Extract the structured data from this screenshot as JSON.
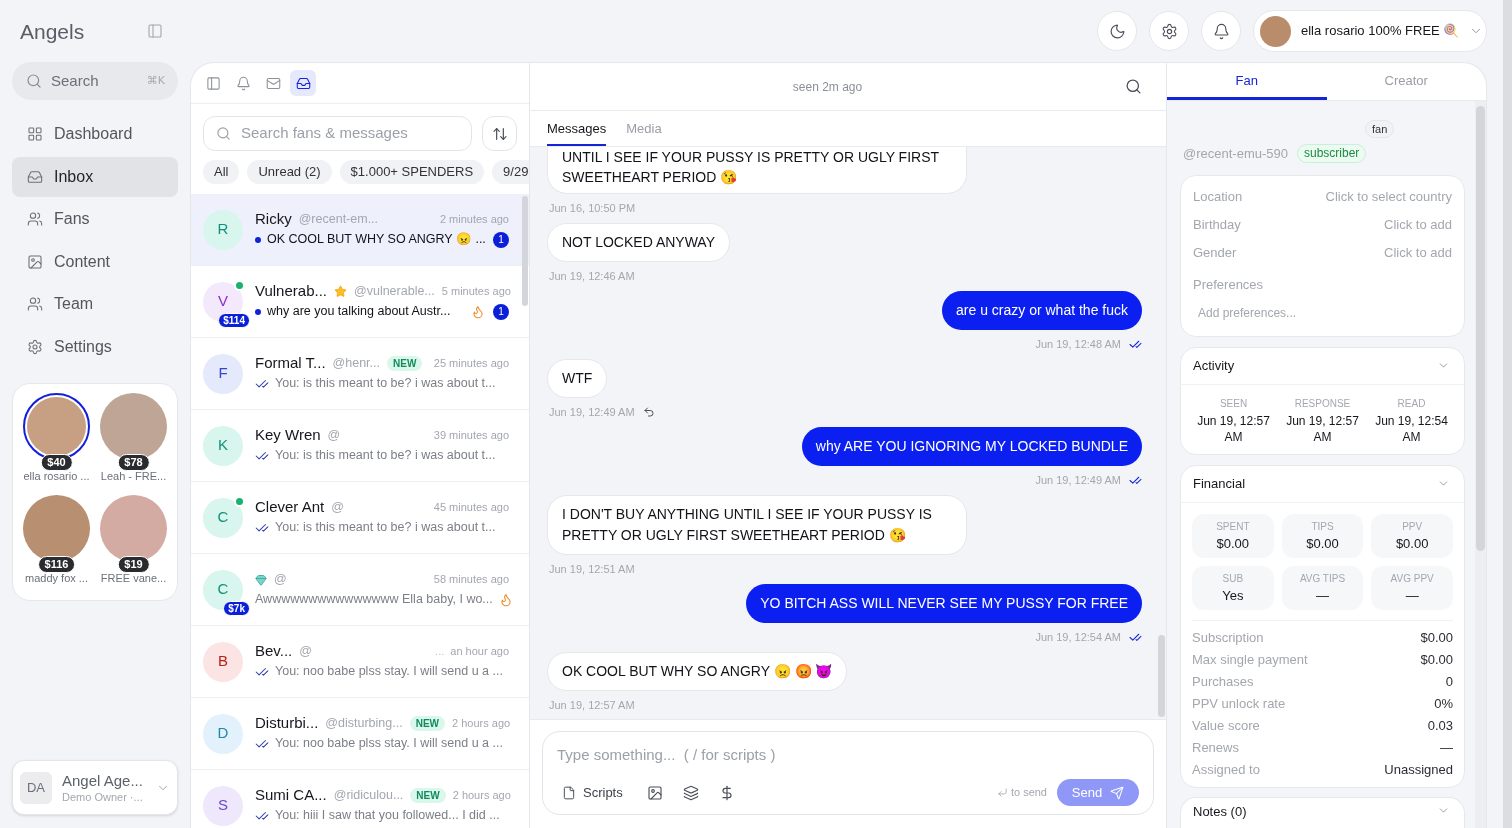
{
  "sidebar": {
    "brand": "Angels",
    "search": {
      "label": "Search",
      "shortcut": "⌘K"
    },
    "nav": [
      {
        "kind": "grid",
        "label": "Dashboard",
        "selected": false
      },
      {
        "kind": "inbox",
        "label": "Inbox",
        "selected": true
      },
      {
        "kind": "users",
        "label": "Fans",
        "selected": false
      },
      {
        "kind": "image",
        "label": "Content",
        "selected": false
      },
      {
        "kind": "users",
        "label": "Team",
        "selected": false
      },
      {
        "kind": "settings",
        "label": "Settings",
        "selected": false
      }
    ],
    "creators": [
      {
        "name": "ella rosario ...",
        "earnings": "$40",
        "selected": true
      },
      {
        "name": "Leah - FRE...",
        "earnings": "$78",
        "selected": false
      },
      {
        "name": "maddy fox ...",
        "earnings": "$116",
        "selected": false
      },
      {
        "name": "FREE vane...",
        "earnings": "$19",
        "selected": false
      }
    ],
    "user": {
      "initials": "DA",
      "name": "Angel Age...",
      "role": "Demo Owner ·..."
    }
  },
  "top_bar": {
    "account": {
      "name": "ella rosario 100% FREE 🍭"
    }
  },
  "inbox": {
    "toolbar": [
      {
        "kind": "panel",
        "selected": false
      },
      {
        "kind": "bell",
        "selected": false
      },
      {
        "kind": "mail",
        "selected": false
      },
      {
        "kind": "inbox",
        "selected": true
      }
    ],
    "search": {
      "placeholder": "Search fans & messages"
    },
    "filters": [
      "All",
      "Unread (2)",
      "$1.000+ SPENDERS",
      "9/29"
    ],
    "conversations": [
      {
        "kind": "plain",
        "initial": "R",
        "color": "#d8f6ee",
        "name": "Ricky",
        "handle": "@recent-em...",
        "time": "2 minutes ago",
        "preview": "OK COOL BUT WHY SO ANGRY 😠 ...",
        "unread": true,
        "unread_count": "1",
        "read": false,
        "online": false,
        "hot": false,
        "selected": true
      },
      {
        "kind": "star",
        "initial": "V",
        "color": "#f3e8fc",
        "name": "Vulnerab...",
        "handle": "@vulnerable...",
        "time": "5 minutes ago",
        "preview": "why are you talking about Austr...",
        "unread": true,
        "unread_count": "1",
        "read": false,
        "online": true,
        "spend": "$114",
        "hot": true,
        "selected": false
      },
      {
        "kind": "plain",
        "initial": "F",
        "color": "#e4e9fb",
        "name": "Formal T...",
        "handle": "@henr...",
        "tag": "NEW",
        "time": "25 minutes ago",
        "preview": "You: is this meant to be? i was about t...",
        "unread": false,
        "read": true,
        "online": false,
        "hot": false,
        "selected": false
      },
      {
        "kind": "plain",
        "initial": "K",
        "color": "#d8f6ee",
        "name": "Key Wren",
        "handle": "@",
        "time": "39 minutes ago",
        "preview": "You: is this meant to be? i was about t...",
        "unread": false,
        "read": true,
        "online": false,
        "hot": false,
        "selected": false
      },
      {
        "kind": "plain",
        "initial": "C",
        "color": "#d8f6ee",
        "name": "Clever Ant",
        "handle": "@",
        "time": "45 minutes ago",
        "preview": "You: is this meant to be? i was about t...",
        "unread": false,
        "read": true,
        "online": true,
        "hot": false,
        "selected": false
      },
      {
        "kind": "gem",
        "initial": "C",
        "color": "#d8f6ee",
        "handle": "@",
        "time": "58 minutes ago",
        "preview": "Awwwwwwwwwwwwwww Ella baby, I wo...",
        "unread": false,
        "read": false,
        "online": false,
        "spend": "$7k",
        "hot": true,
        "selected": false
      },
      {
        "kind": "plain",
        "initial": "B",
        "color": "#fde4e4",
        "name": "Bev...",
        "handle": "@",
        "time_prefix": "...",
        "time": "an hour ago",
        "preview": "You: noo babe plss stay. I will send u a ...",
        "unread": false,
        "read": true,
        "online": false,
        "hot": false,
        "selected": false
      },
      {
        "kind": "plain",
        "initial": "D",
        "color": "#e2f1fc",
        "name": "Disturbi...",
        "handle": "@disturbing...",
        "tag": "NEW",
        "time": "2 hours ago",
        "preview": "You: noo babe plss stay. I will send u a ...",
        "unread": false,
        "read": true,
        "online": false,
        "hot": false,
        "selected": false
      },
      {
        "kind": "plain",
        "initial": "S",
        "color": "#efe7fb",
        "name": "Sumi CA...",
        "handle": "@ridiculou...",
        "tag": "NEW",
        "time": "2 hours ago",
        "preview": "You: hiii I saw that you followed... I did ...",
        "unread": false,
        "read": true,
        "online": false,
        "hot": false,
        "selected": false
      }
    ]
  },
  "chat": {
    "status": "seen 2m ago",
    "tabs": [
      {
        "label": "Messages",
        "selected": true
      },
      {
        "label": "Media",
        "selected": false
      }
    ],
    "messages": [
      {
        "kind": "incoming",
        "text": "UNTIL I SEE IF YOUR PUSSY IS PRETTY OR UGLY FIRST SWEETHEART PERIOD 😘",
        "time": "Jun 16, 10:50 PM",
        "cut_off": true,
        "read": false,
        "replied": false
      },
      {
        "kind": "incoming",
        "text": "NOT LOCKED ANYWAY",
        "time": "Jun 19, 12:46 AM",
        "cut_off": false,
        "read": false,
        "replied": false
      },
      {
        "kind": "outgoing",
        "text": "are u crazy or what the fuck",
        "time": "Jun 19, 12:48 AM",
        "cut_off": false,
        "read": true,
        "replied": false
      },
      {
        "kind": "incoming",
        "text": "WTF",
        "time": "Jun 19, 12:49 AM",
        "cut_off": false,
        "read": false,
        "replied": true
      },
      {
        "kind": "outgoing",
        "text": "why ARE YOU IGNORING MY LOCKED BUNDLE",
        "time": "Jun 19, 12:49 AM",
        "cut_off": false,
        "read": true,
        "replied": false
      },
      {
        "kind": "incoming",
        "text": "I DON'T BUY ANYTHING UNTIL I SEE IF YOUR PUSSY IS PRETTY OR UGLY FIRST SWEETHEART PERIOD 😘",
        "time": "Jun 19, 12:51 AM",
        "cut_off": false,
        "read": false,
        "replied": false
      },
      {
        "kind": "outgoing",
        "text": "YO BITCH ASS WILL NEVER SEE MY PUSSY FOR FREE",
        "time": "Jun 19, 12:54 AM",
        "cut_off": false,
        "read": true,
        "replied": false
      },
      {
        "kind": "incoming",
        "text": "OK COOL BUT WHY SO ANGRY 😠 😡 😈",
        "time": "Jun 19, 12:57 AM",
        "cut_off": false,
        "read": false,
        "replied": false
      }
    ],
    "composer": {
      "placeholder": "Type something...  ( / for scripts )",
      "scripts_label": "Scripts",
      "send_hint": "to send",
      "send": {
        "label": "Send",
        "disabled": true
      }
    }
  },
  "fan_panel": {
    "tabs": [
      {
        "label": "Fan",
        "selected": true
      },
      {
        "label": "Creator",
        "selected": false
      }
    ],
    "role": "fan",
    "handle": "@recent-emu-590",
    "status": "subscriber",
    "fields": [
      {
        "label": "Location",
        "placeholder": "Click to select country"
      },
      {
        "label": "Birthday",
        "placeholder": "Click to add"
      },
      {
        "label": "Gender",
        "placeholder": "Click to add"
      }
    ],
    "preferences": {
      "label": "Preferences",
      "placeholder": "Add preferences..."
    },
    "activity": {
      "title": "Activity",
      "expanded": true,
      "stats": [
        {
          "label": "SEEN",
          "value": "Jun 19, 12:57 AM"
        },
        {
          "label": "RESPONSE",
          "value": "Jun 19, 12:57 AM"
        },
        {
          "label": "READ",
          "value": "Jun 19, 12:54 AM"
        }
      ]
    },
    "financial": {
      "title": "Financial",
      "expanded": true,
      "tiles": [
        {
          "label": "SPENT",
          "value": "$0.00"
        },
        {
          "label": "TIPS",
          "value": "$0.00"
        },
        {
          "label": "PPV",
          "value": "$0.00"
        },
        {
          "label": "SUB",
          "value": "Yes"
        },
        {
          "label": "AVG TIPS",
          "value": "—"
        },
        {
          "label": "AVG PPV",
          "value": "—"
        }
      ],
      "rows": [
        {
          "label": "Subscription",
          "value": "$0.00"
        },
        {
          "label": "Max single payment",
          "value": "$0.00"
        },
        {
          "label": "Purchases",
          "value": "0"
        },
        {
          "label": "PPV unlock rate",
          "value": "0%"
        },
        {
          "label": "Value score",
          "value": "0.03"
        },
        {
          "label": "Renews",
          "value": "—"
        },
        {
          "label": "Assigned to",
          "value": "Unassigned"
        }
      ]
    },
    "notes": {
      "title": "Notes (0)"
    }
  }
}
